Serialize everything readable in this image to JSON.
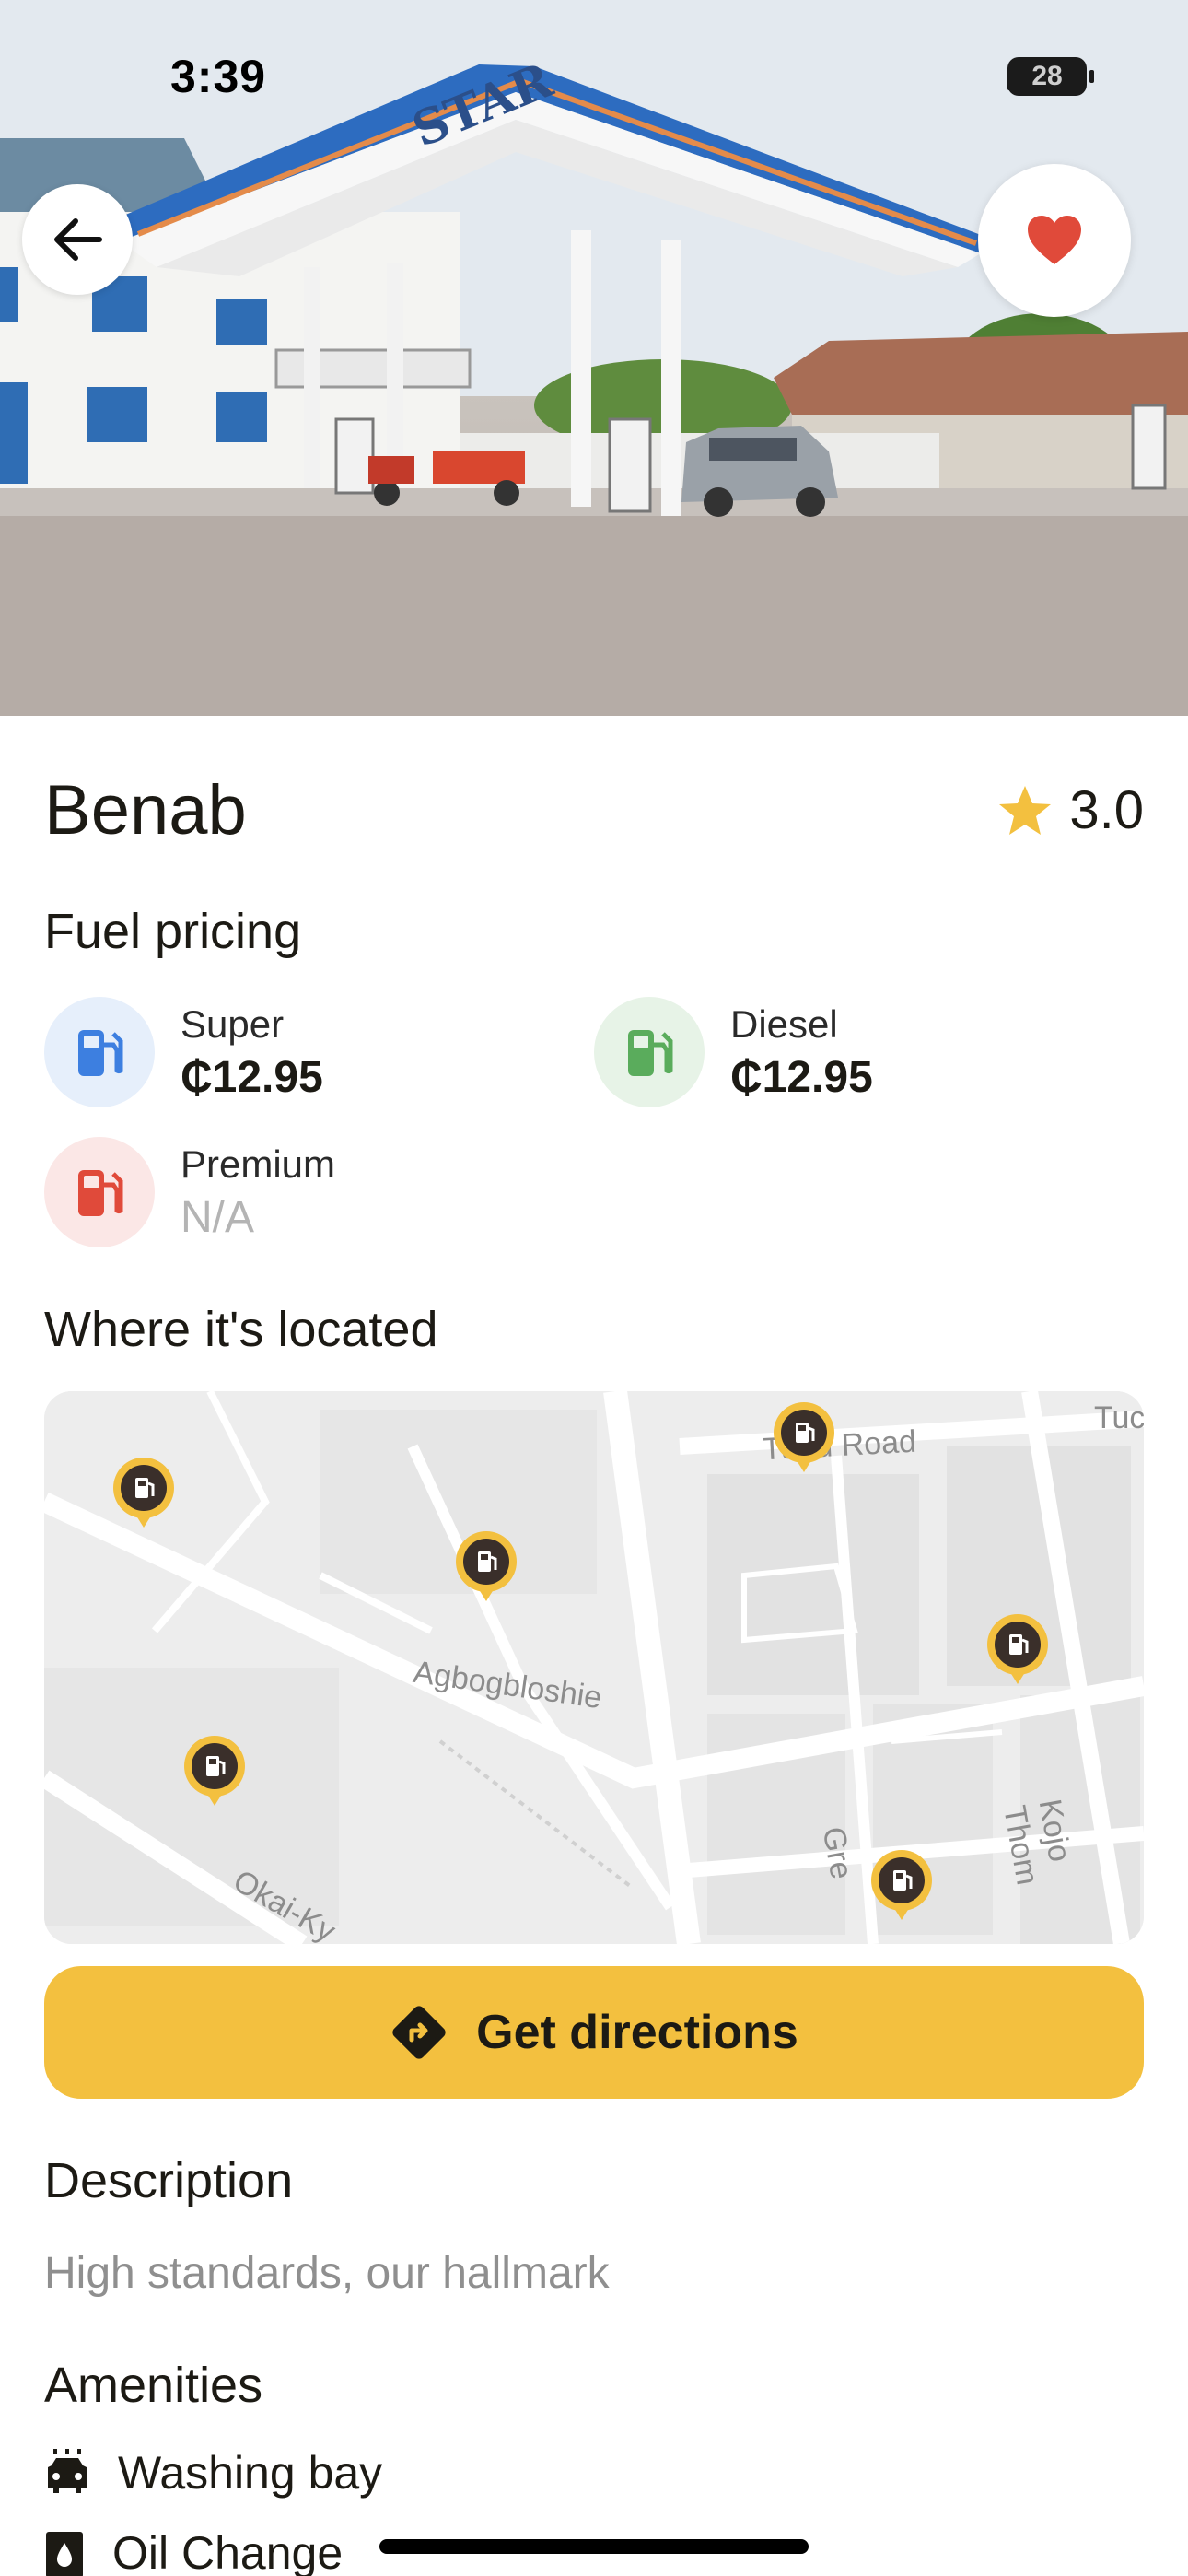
{
  "status_bar": {
    "time": "3:39",
    "battery": "28"
  },
  "station": {
    "name": "Benab",
    "rating": "3.0",
    "canopy_brand": "STAR"
  },
  "fuel_section": {
    "title": "Fuel pricing",
    "items": [
      {
        "name": "Super",
        "price": "₵12.95",
        "color": "#3d7fe0",
        "bg": "#e6effb"
      },
      {
        "name": "Diesel",
        "price": "₵12.95",
        "color": "#5aac5c",
        "bg": "#e7f3e7"
      },
      {
        "name": "Premium",
        "price": "N/A",
        "color": "#e04a3a",
        "bg": "#fbe7e6"
      }
    ]
  },
  "location_section": {
    "title": "Where it's located",
    "map_labels": {
      "road1": "Tudu Road",
      "road2": "Agbogbloshie",
      "road3": "Kojo Thom",
      "road4": "Okai-Ky",
      "road5": "Gre",
      "road6": "Tuc"
    }
  },
  "directions_button": {
    "label": "Get directions"
  },
  "description": {
    "title": "Description",
    "text": "High standards, our hallmark"
  },
  "amenities": {
    "title": "Amenities",
    "items": [
      {
        "label": "Washing bay",
        "icon": "car-wash-icon"
      },
      {
        "label": "Oil Change",
        "icon": "oil-can-icon"
      }
    ]
  },
  "colors": {
    "accent": "#f3c03f",
    "favorite": "#e04a3a",
    "star": "#f3c03f"
  }
}
